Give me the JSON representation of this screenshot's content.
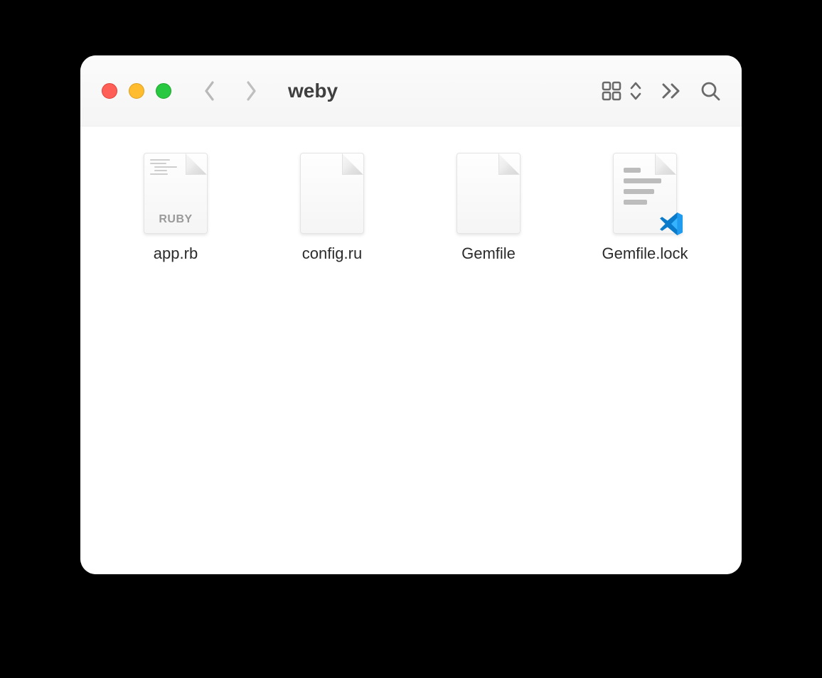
{
  "window": {
    "title": "weby"
  },
  "traffic_lights": {
    "close_color": "#ff5f57",
    "minimize_color": "#febc2e",
    "zoom_color": "#28c840"
  },
  "toolbar": {
    "back_icon": "chevron-left",
    "forward_icon": "chevron-right",
    "view_icon": "grid-view",
    "view_switcher_icon": "up-down-chevrons",
    "overflow_icon": "double-chevron-right",
    "search_icon": "magnifying-glass"
  },
  "files": [
    {
      "name": "app.rb",
      "icon": "ruby-file"
    },
    {
      "name": "config.ru",
      "icon": "generic-file"
    },
    {
      "name": "Gemfile",
      "icon": "generic-file"
    },
    {
      "name": "Gemfile.lock",
      "icon": "vscode-doc-file"
    }
  ]
}
